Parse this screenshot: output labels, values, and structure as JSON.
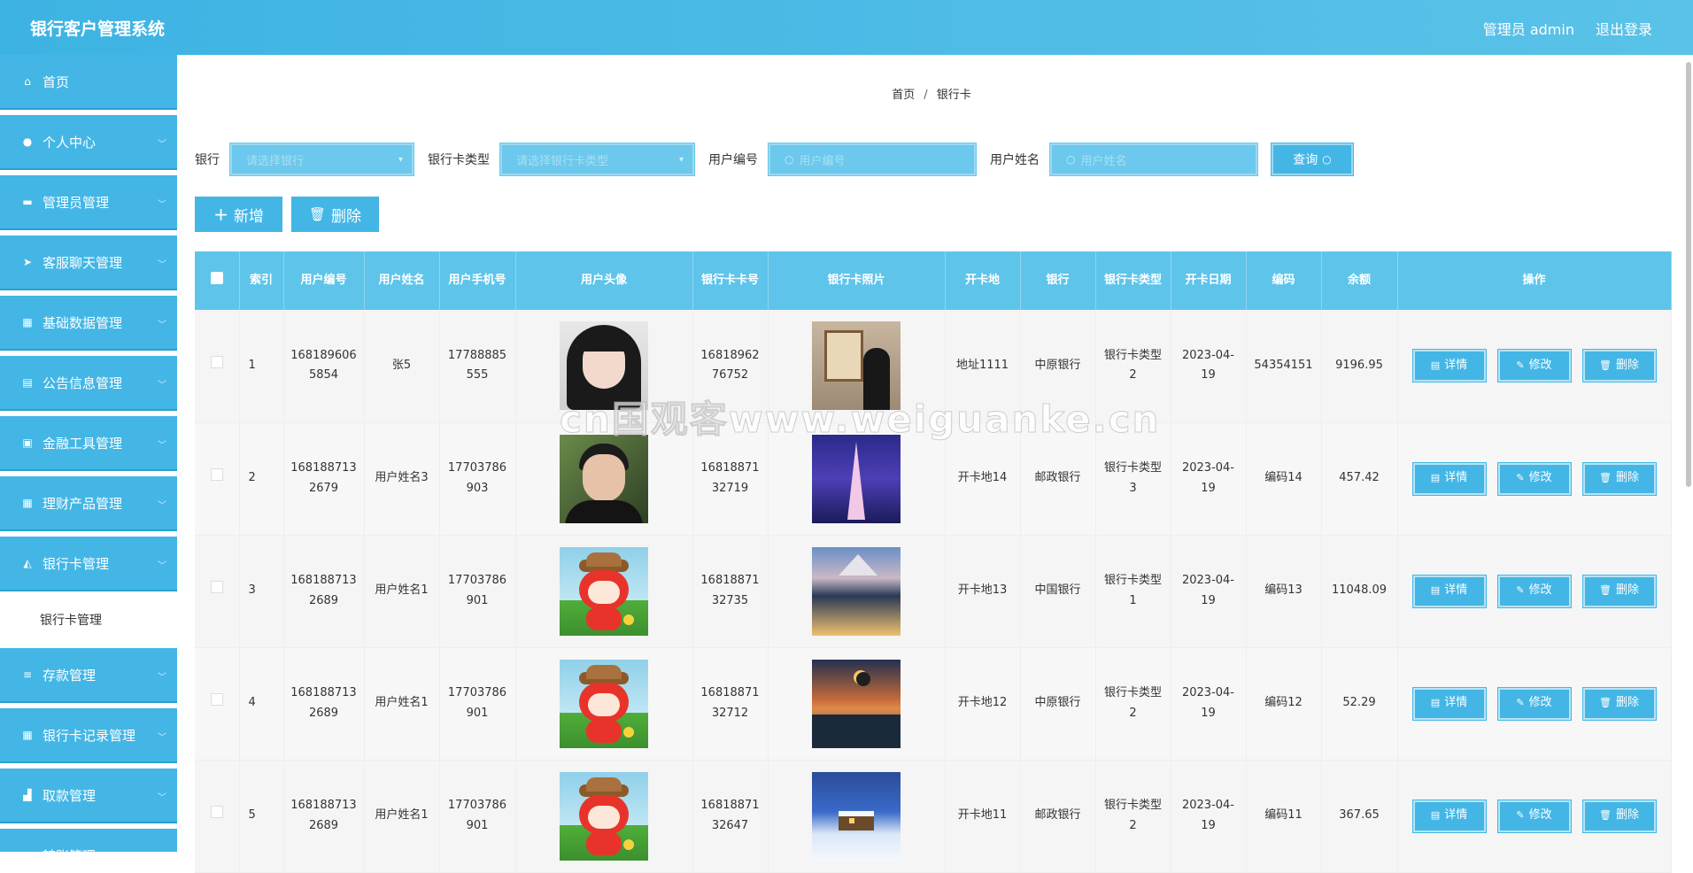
{
  "app": {
    "title": "银行客户管理系统",
    "admin_label": "管理员 admin",
    "logout_label": "退出登录"
  },
  "sidebar": {
    "items": [
      {
        "label": "首页",
        "icon": "home-icon",
        "glyph": "⌂"
      },
      {
        "label": "个人中心",
        "icon": "user-icon",
        "glyph": "●"
      },
      {
        "label": "管理员管理",
        "icon": "admin-icon",
        "glyph": "▬"
      },
      {
        "label": "客服聊天管理",
        "icon": "send-icon",
        "glyph": "➤"
      },
      {
        "label": "基础数据管理",
        "icon": "grid-icon",
        "glyph": "▦"
      },
      {
        "label": "公告信息管理",
        "icon": "notice-icon",
        "glyph": "▤"
      },
      {
        "label": "金融工具管理",
        "icon": "tool-icon",
        "glyph": "▣"
      },
      {
        "label": "理财产品管理",
        "icon": "grid-icon",
        "glyph": "▦"
      },
      {
        "label": "银行卡管理",
        "icon": "card-icon",
        "glyph": "◭"
      }
    ],
    "sub_item": "银行卡管理",
    "items_after": [
      {
        "label": "存款管理",
        "icon": "list-icon",
        "glyph": "≡"
      },
      {
        "label": "银行卡记录管理",
        "icon": "grid-icon",
        "glyph": "▦"
      },
      {
        "label": "取款管理",
        "icon": "withdraw-icon",
        "glyph": "▟"
      },
      {
        "label": "转账管理",
        "icon": "transfer-icon",
        "glyph": "⇄"
      }
    ]
  },
  "breadcrumb": {
    "home": "首页",
    "separator": "/",
    "current": "银行卡"
  },
  "filters": {
    "bank_label": "银行",
    "bank_placeholder": "请选择银行",
    "card_type_label": "银行卡类型",
    "card_type_placeholder": "请选择银行卡类型",
    "user_no_label": "用户编号",
    "user_no_placeholder": "用户编号",
    "user_name_label": "用户姓名",
    "user_name_placeholder": "用户姓名",
    "search_label": "查询"
  },
  "actions": {
    "add_label": "新增",
    "delete_label": "删除"
  },
  "table": {
    "headers": [
      "索引",
      "用户编号",
      "用户姓名",
      "用户手机号",
      "用户头像",
      "银行卡卡号",
      "银行卡照片",
      "开卡地",
      "银行",
      "银行卡类型",
      "开卡日期",
      "编码",
      "余额",
      "操作"
    ],
    "rows": [
      {
        "index": "1",
        "user_no": "1681896065854",
        "user_name": "张5",
        "phone": "17788885555",
        "card_no": "1681896276752",
        "place": "地址1111",
        "bank": "中原银行",
        "card_type": "银行卡类型2",
        "date": "2023-04-19",
        "code": "54354151",
        "balance": "9196.95",
        "avatar": "girl",
        "card_photo": "art"
      },
      {
        "index": "2",
        "user_no": "1681887132679",
        "user_name": "用户姓名3",
        "phone": "17703786903",
        "card_no": "1681887132719",
        "place": "开卡地14",
        "bank": "邮政银行",
        "card_type": "银行卡类型3",
        "date": "2023-04-19",
        "code": "编码14",
        "balance": "457.42",
        "avatar": "boy",
        "card_photo": "tower"
      },
      {
        "index": "3",
        "user_no": "1681887132689",
        "user_name": "用户姓名1",
        "phone": "17703786901",
        "card_no": "1681887132735",
        "place": "开卡地13",
        "bank": "中国银行",
        "card_type": "银行卡类型1",
        "date": "2023-04-19",
        "code": "编码13",
        "balance": "11048.09",
        "avatar": "cartoon",
        "card_photo": "city"
      },
      {
        "index": "4",
        "user_no": "1681887132689",
        "user_name": "用户姓名1",
        "phone": "17703786901",
        "card_no": "1681887132712",
        "place": "开卡地12",
        "bank": "中原银行",
        "card_type": "银行卡类型2",
        "date": "2023-04-19",
        "code": "编码12",
        "balance": "52.29",
        "avatar": "cartoon",
        "card_photo": "sunset"
      },
      {
        "index": "5",
        "user_no": "1681887132689",
        "user_name": "用户姓名1",
        "phone": "17703786901",
        "card_no": "1681887132647",
        "place": "开卡地11",
        "bank": "邮政银行",
        "card_type": "银行卡类型2",
        "date": "2023-04-19",
        "code": "编码11",
        "balance": "367.65",
        "avatar": "cartoon",
        "card_photo": "snow"
      }
    ],
    "row_actions": {
      "detail": "详情",
      "edit": "修改",
      "delete": "删除"
    }
  },
  "watermark": "cn国观客www.weiguanke.cn",
  "colors": {
    "primary": "#43b6e6",
    "header": "#5ec4ea"
  }
}
